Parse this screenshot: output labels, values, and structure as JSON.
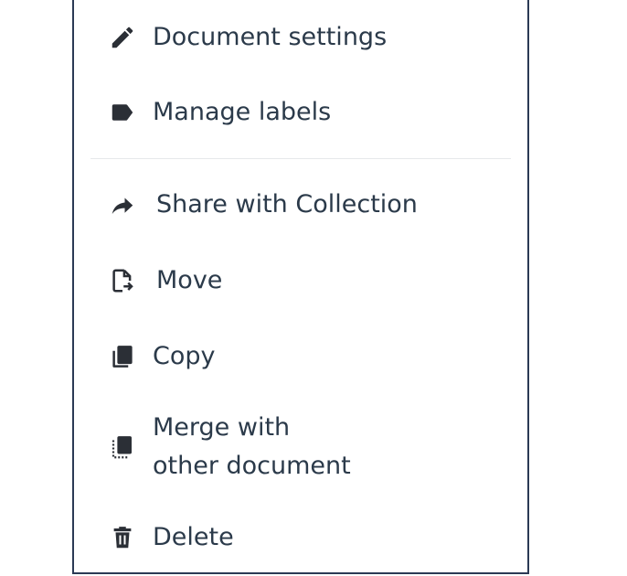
{
  "menu": {
    "items": [
      {
        "label": "Document settings",
        "icon": "pencil-icon"
      },
      {
        "label": "Manage labels",
        "icon": "label-tag-icon"
      },
      {
        "label": "Share with Collection",
        "icon": "share-arrow-icon"
      },
      {
        "label": "Move",
        "icon": "move-document-icon"
      },
      {
        "label": "Copy",
        "icon": "copy-icon"
      },
      {
        "label": "Merge with",
        "label2": "other document",
        "icon": "merge-document-icon"
      },
      {
        "label": "Delete",
        "icon": "trash-icon"
      }
    ]
  },
  "colors": {
    "text": "#2b3a4a",
    "border": "#2b3a55",
    "divider": "#e6e8eb",
    "icon": "#2b2f36"
  }
}
